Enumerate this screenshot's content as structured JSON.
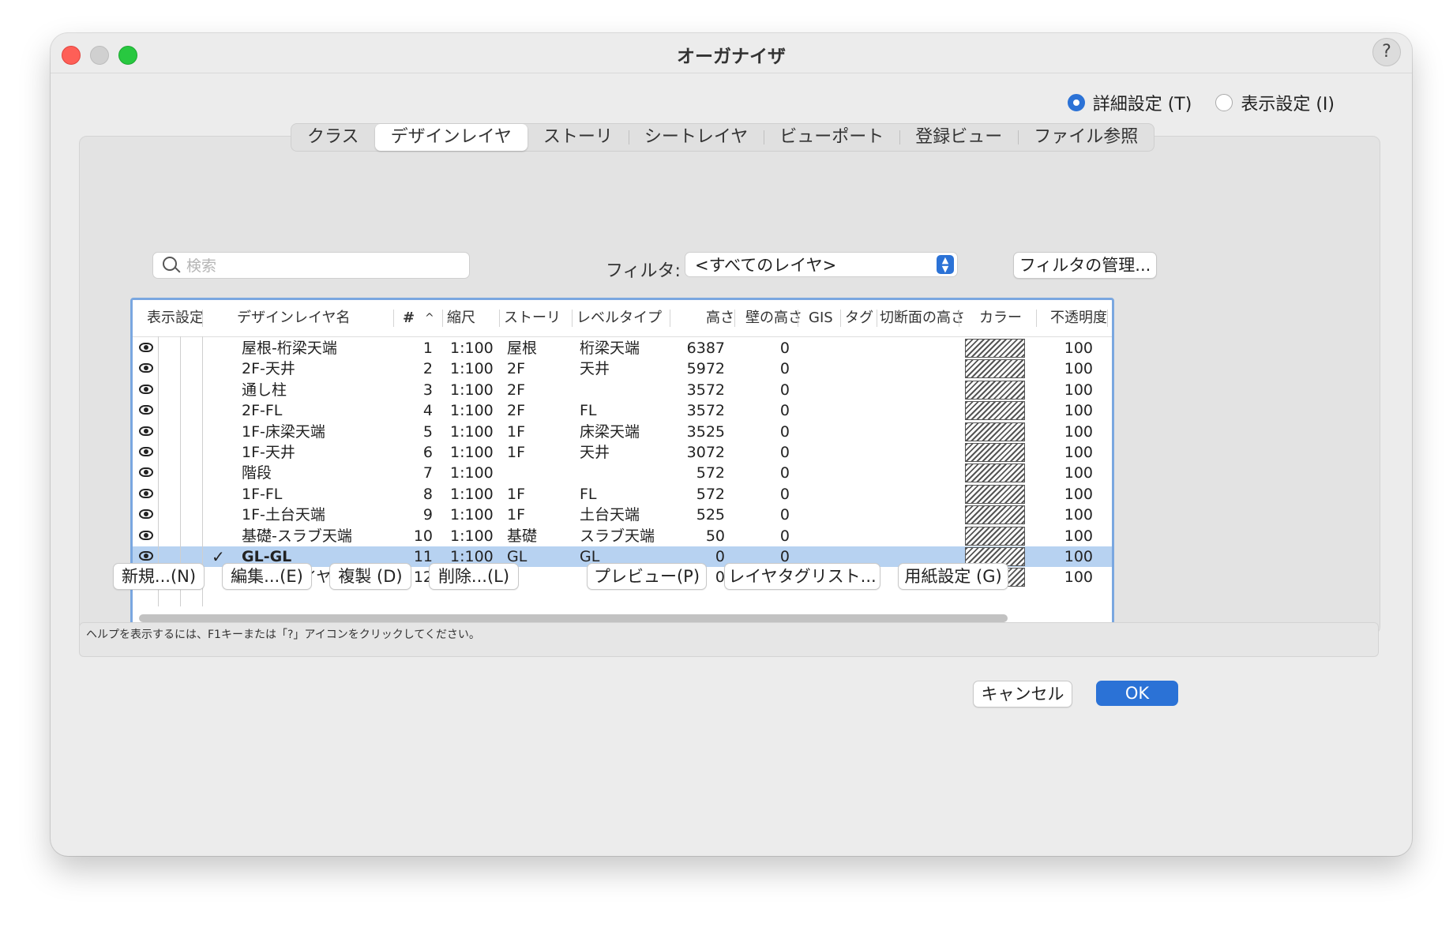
{
  "window": {
    "title": "オーガナイザ",
    "help_label": "?"
  },
  "view_mode": {
    "options": [
      "詳細設定 (T)",
      "表示設定 (I)"
    ],
    "selected": 0
  },
  "tabs": [
    "クラス",
    "デザインレイヤ",
    "ストーリ",
    "シートレイヤ",
    "ビューポート",
    "登録ビュー",
    "ファイル参照"
  ],
  "active_tab": "デザインレイヤ",
  "search": {
    "placeholder": "検索",
    "value": ""
  },
  "filter": {
    "label": "フィルタ:",
    "value": "<すべてのレイヤ>",
    "manage_label": "フィルタの管理..."
  },
  "table": {
    "headers": {
      "visibility": "表示設定",
      "name": "デザインレイヤ名",
      "number": "#",
      "sort_indicator": "^",
      "scale": "縮尺",
      "story": "ストーリ",
      "level_type": "レベルタイプ",
      "height": "高さ",
      "wall_height": "壁の高さ",
      "gis": "GIS",
      "tag": "タグ",
      "cut_height": "切断面の高さ",
      "color": "カラー",
      "opacity": "不透明度"
    },
    "rows": [
      {
        "vis": "eye",
        "active": false,
        "name": "屋根-桁梁天端",
        "num": "1",
        "scale": "1:100",
        "story": "屋根",
        "level": "桁梁天端",
        "height": "6387",
        "wall": "0",
        "opacity": "100"
      },
      {
        "vis": "eye",
        "active": false,
        "name": "2F-天井",
        "num": "2",
        "scale": "1:100",
        "story": "2F",
        "level": "天井",
        "height": "5972",
        "wall": "0",
        "opacity": "100"
      },
      {
        "vis": "eye",
        "active": false,
        "name": "通し柱",
        "num": "3",
        "scale": "1:100",
        "story": "2F",
        "level": "",
        "height": "3572",
        "wall": "0",
        "opacity": "100"
      },
      {
        "vis": "eye",
        "active": false,
        "name": "2F-FL",
        "num": "4",
        "scale": "1:100",
        "story": "2F",
        "level": "FL",
        "height": "3572",
        "wall": "0",
        "opacity": "100"
      },
      {
        "vis": "eye",
        "active": false,
        "name": "1F-床梁天端",
        "num": "5",
        "scale": "1:100",
        "story": "1F",
        "level": "床梁天端",
        "height": "3525",
        "wall": "0",
        "opacity": "100"
      },
      {
        "vis": "eye",
        "active": false,
        "name": "1F-天井",
        "num": "6",
        "scale": "1:100",
        "story": "1F",
        "level": "天井",
        "height": "3072",
        "wall": "0",
        "opacity": "100"
      },
      {
        "vis": "eye",
        "active": false,
        "name": "階段",
        "num": "7",
        "scale": "1:100",
        "story": "",
        "level": "",
        "height": "572",
        "wall": "0",
        "opacity": "100"
      },
      {
        "vis": "eye",
        "active": false,
        "name": "1F-FL",
        "num": "8",
        "scale": "1:100",
        "story": "1F",
        "level": "FL",
        "height": "572",
        "wall": "0",
        "opacity": "100"
      },
      {
        "vis": "eye",
        "active": false,
        "name": "1F-土台天端",
        "num": "9",
        "scale": "1:100",
        "story": "1F",
        "level": "土台天端",
        "height": "525",
        "wall": "0",
        "opacity": "100"
      },
      {
        "vis": "eye",
        "active": false,
        "name": "基礎-スラブ天端",
        "num": "10",
        "scale": "1:100",
        "story": "基礎",
        "level": "スラブ天端",
        "height": "50",
        "wall": "0",
        "opacity": "100"
      },
      {
        "vis": "eye",
        "active": true,
        "name": "GL-GL",
        "num": "11",
        "scale": "1:100",
        "story": "GL",
        "level": "GL",
        "height": "0",
        "wall": "0",
        "opacity": "100"
      },
      {
        "vis": "hidden",
        "active": false,
        "name": "通り芯レイヤ",
        "num": "12",
        "scale": "1:100",
        "story": "",
        "level": "",
        "height": "0",
        "wall": "0",
        "opacity": "100"
      }
    ]
  },
  "buttons": {
    "new": "新規...(N)",
    "edit": "編集...(E)",
    "duplicate": "複製 (D)",
    "delete": "削除...(L)",
    "preview": "プレビュー(P)",
    "layer_tags": "レイヤタグリスト...",
    "page_setup": "用紙設定 (G)"
  },
  "help_text": "ヘルプを表示するには、F1キーまたは「?」アイコンをクリックしてください。",
  "footer": {
    "cancel": "キャンセル",
    "ok": "OK"
  },
  "colors": {
    "accent": "#2b72d6",
    "selection": "#b7d2f1",
    "close": "#fe5f57",
    "zoom": "#28c840"
  }
}
